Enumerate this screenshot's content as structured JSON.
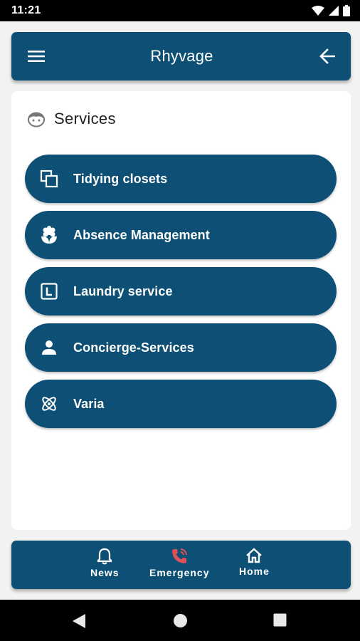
{
  "status_bar": {
    "time": "11:21",
    "icons": [
      "wifi-icon",
      "signal-icon",
      "battery-icon"
    ]
  },
  "app_bar": {
    "title": "Rhyvage",
    "left_icon": "menu-icon",
    "right_icon": "arrow-back-icon",
    "background": "#0d4f75"
  },
  "card": {
    "title": "Services",
    "icon": "face-icon",
    "items": [
      {
        "label": "Tidying closets",
        "icon": "copy-icon"
      },
      {
        "label": "Absence Management",
        "icon": "flower-icon"
      },
      {
        "label": "Laundry service",
        "icon": "letter-l-icon"
      },
      {
        "label": "Concierge-Services",
        "icon": "person-icon"
      },
      {
        "label": "Varia",
        "icon": "atom-icon"
      }
    ]
  },
  "bottom_nav": {
    "items": [
      {
        "label": "News",
        "icon": "bell-icon",
        "color": "#ffffff"
      },
      {
        "label": "Emergency",
        "icon": "phone-call-icon",
        "color": "#e0505a"
      },
      {
        "label": "Home",
        "icon": "home-icon",
        "color": "#ffffff"
      }
    ]
  },
  "system_nav": {
    "buttons": [
      "back-triangle-icon",
      "home-circle-icon",
      "recents-square-icon"
    ]
  }
}
